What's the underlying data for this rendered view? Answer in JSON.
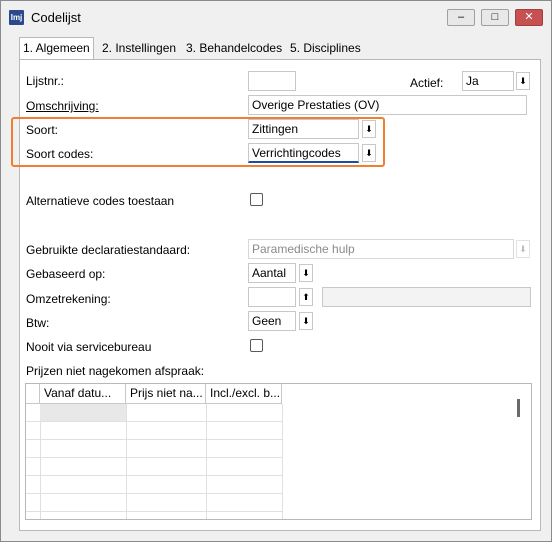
{
  "window": {
    "title": "Codelijst",
    "icon_text": "Imj",
    "controls": [
      "minimize-icon",
      "maximize-icon",
      "close-icon"
    ]
  },
  "tabs": [
    {
      "label": "1. Algemeen",
      "active": true
    },
    {
      "label": "2. Instellingen",
      "active": false
    },
    {
      "label": "3. Behandelcodes",
      "active": false
    },
    {
      "label": "5. Disciplines",
      "active": false
    }
  ],
  "form": {
    "lijstnr_label": "Lijstnr.:",
    "lijstnr_value": "",
    "actief_label": "Actief:",
    "actief_value": "Ja",
    "omschrijving_label": "Omschrijving:",
    "omschrijving_value": "Overige Prestaties (OV)",
    "soort_label": "Soort:",
    "soort_value": "Zittingen",
    "soort_codes_label": "Soort codes:",
    "soort_codes_value": "Verrichtingcodes",
    "alternatieve_label": "Alternatieve codes toestaan",
    "alternatieve_checked": false,
    "declaratiestandaard_label": "Gebruikte declaratiestandaard:",
    "declaratiestandaard_value": "Paramedische hulp",
    "gebaseerd_label": "Gebaseerd op:",
    "gebaseerd_value": "Aantal",
    "omzetrekening_label": "Omzetrekening:",
    "omzetrekening_value": "",
    "btw_label": "Btw:",
    "btw_value": "Geen",
    "nooit_label": "Nooit via servicebureau",
    "nooit_checked": false,
    "prijzen_label": "Prijzen niet nagekomen afspraak:"
  },
  "grid": {
    "columns": [
      "Vanaf datu...",
      "Prijs niet na...",
      "Incl./excl. b..."
    ],
    "rows": []
  },
  "colors": {
    "highlight": "#f08030",
    "focus": "#1a4fa0"
  }
}
